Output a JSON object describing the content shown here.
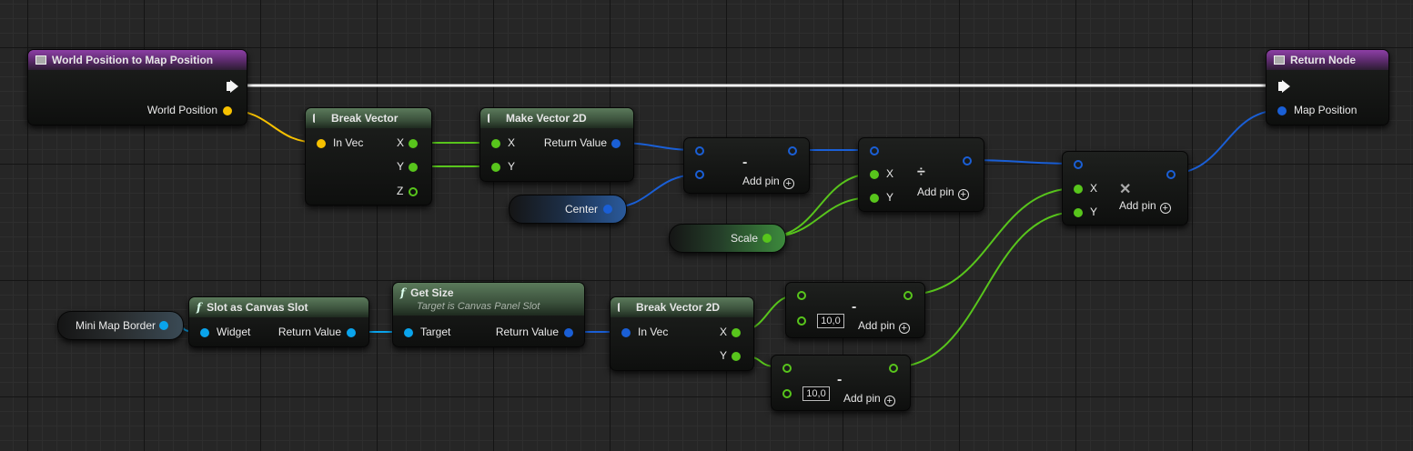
{
  "colors": {
    "exec": "#f5f5f5",
    "vector": "#f7c100",
    "float": "#58c51c",
    "vector2d": "#1a5fd6",
    "object": "#0aa4ec"
  },
  "nodes": {
    "world_to_map": {
      "title": "World Position to Map Position",
      "icon": "function-entry-icon",
      "pin_world_position": "World Position"
    },
    "return_node": {
      "title": "Return Node",
      "icon": "function-entry-icon",
      "pin_map_position": "Map Position"
    },
    "break_vector": {
      "title": "Break Vector",
      "icon": "break-icon",
      "pin_in_vec": "In Vec",
      "pin_x": "X",
      "pin_y": "Y",
      "pin_z": "Z"
    },
    "make_vector_2d": {
      "title": "Make Vector 2D",
      "icon": "make-icon",
      "pin_x": "X",
      "pin_y": "Y",
      "pin_return": "Return Value"
    },
    "subtract": {
      "symbol": "-",
      "add_pin": "Add pin"
    },
    "divide": {
      "symbol": "÷",
      "pin_x": "X",
      "pin_y": "Y",
      "add_pin": "Add pin"
    },
    "multiply": {
      "symbol": "✕",
      "pin_x": "X",
      "pin_y": "Y",
      "add_pin": "Add pin"
    },
    "slot_as_canvas": {
      "title": "Slot as Canvas Slot",
      "icon": "f",
      "pin_widget": "Widget",
      "pin_return": "Return Value"
    },
    "get_size": {
      "title": "Get Size",
      "subtitle": "Target is Canvas Panel Slot",
      "icon": "f",
      "pin_target": "Target",
      "pin_return": "Return Value"
    },
    "break_vector_2d": {
      "title": "Break Vector 2D",
      "icon": "break-icon",
      "pin_in_vec": "In Vec",
      "pin_x": "X",
      "pin_y": "Y"
    },
    "subtract_x": {
      "symbol": "-",
      "value": "10,0",
      "add_pin": "Add pin"
    },
    "subtract_y": {
      "symbol": "-",
      "value": "10,0",
      "add_pin": "Add pin"
    }
  },
  "variables": {
    "center": "Center",
    "scale": "Scale",
    "mini_map_border": "Mini Map Border"
  },
  "add_pin_symbol": "+"
}
